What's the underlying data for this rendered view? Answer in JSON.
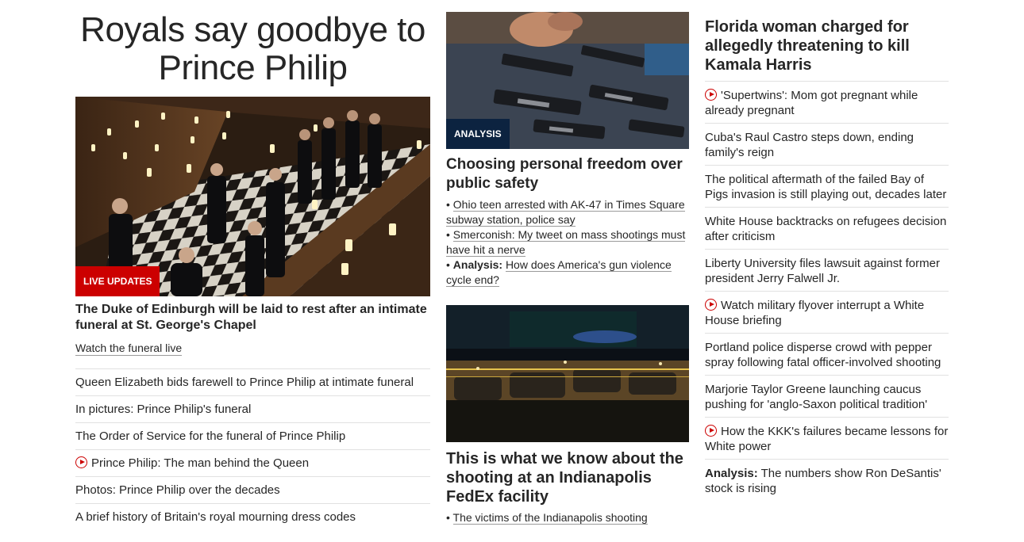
{
  "lead": {
    "headline": "Royals say goodbye to Prince Philip",
    "badge": "LIVE UPDATES",
    "title": "The Duke of Edinburgh will be laid to rest after an intimate funeral at St. George's Chapel",
    "sublink": "Watch the funeral live",
    "items": [
      {
        "text": "Queen Elizabeth bids farewell to Prince Philip at intimate funeral",
        "video": false
      },
      {
        "text": "In pictures: Prince Philip's funeral",
        "video": false
      },
      {
        "text": "The Order of Service for the funeral of Prince Philip",
        "video": false
      },
      {
        "text": "Prince Philip: The man behind the Queen",
        "video": true
      },
      {
        "text": "Photos: Prince Philip over the decades",
        "video": false
      },
      {
        "text": "A brief history of Britain's royal mourning dress codes",
        "video": false
      }
    ]
  },
  "middle": {
    "card1": {
      "badge": "ANALYSIS",
      "title": "Choosing personal freedom over public safety",
      "bullets": [
        {
          "prefix": "",
          "text": "Ohio teen arrested with AK-47 in Times Square subway station, police say"
        },
        {
          "prefix": "",
          "text": "Smerconish: My tweet on mass shootings must have hit a nerve"
        },
        {
          "prefix": "Analysis:",
          "text": "How does America's gun violence cycle end?"
        }
      ]
    },
    "card2": {
      "title": "This is what we know about the shooting at an Indianapolis FedEx facility",
      "bullets": [
        {
          "prefix": "",
          "text": "The victims of the Indianapolis shooting"
        }
      ]
    }
  },
  "right": {
    "title": "Florida woman charged for allegedly threatening to kill Kamala Harris",
    "items": [
      {
        "prefix": "",
        "text": "'Supertwins': Mom got pregnant while already pregnant",
        "video": true
      },
      {
        "prefix": "",
        "text": "Cuba's Raul Castro steps down, ending family's reign",
        "video": false
      },
      {
        "prefix": "",
        "text": "The political aftermath of the failed Bay of Pigs invasion is still playing out, decades later",
        "video": false
      },
      {
        "prefix": "",
        "text": "White House backtracks on refugees decision after criticism",
        "video": false
      },
      {
        "prefix": "",
        "text": "Liberty University files lawsuit against former president Jerry Falwell Jr.",
        "video": false
      },
      {
        "prefix": "",
        "text": "Watch military flyover interrupt a White House briefing",
        "video": true
      },
      {
        "prefix": "",
        "text": "Portland police disperse crowd with pepper spray following fatal officer-involved shooting",
        "video": false
      },
      {
        "prefix": "",
        "text": "Marjorie Taylor Greene launching caucus pushing for 'anglo-Saxon political tradition'",
        "video": false
      },
      {
        "prefix": "",
        "text": "How the KKK's failures became lessons for White power",
        "video": true
      },
      {
        "prefix": "Analysis:",
        "text": "The numbers show Ron DeSantis' stock is rising",
        "video": false
      }
    ]
  },
  "colors": {
    "live": "#cc0000",
    "analysis": "#0c2340",
    "text": "#262626",
    "divider": "#e1e1e1"
  }
}
